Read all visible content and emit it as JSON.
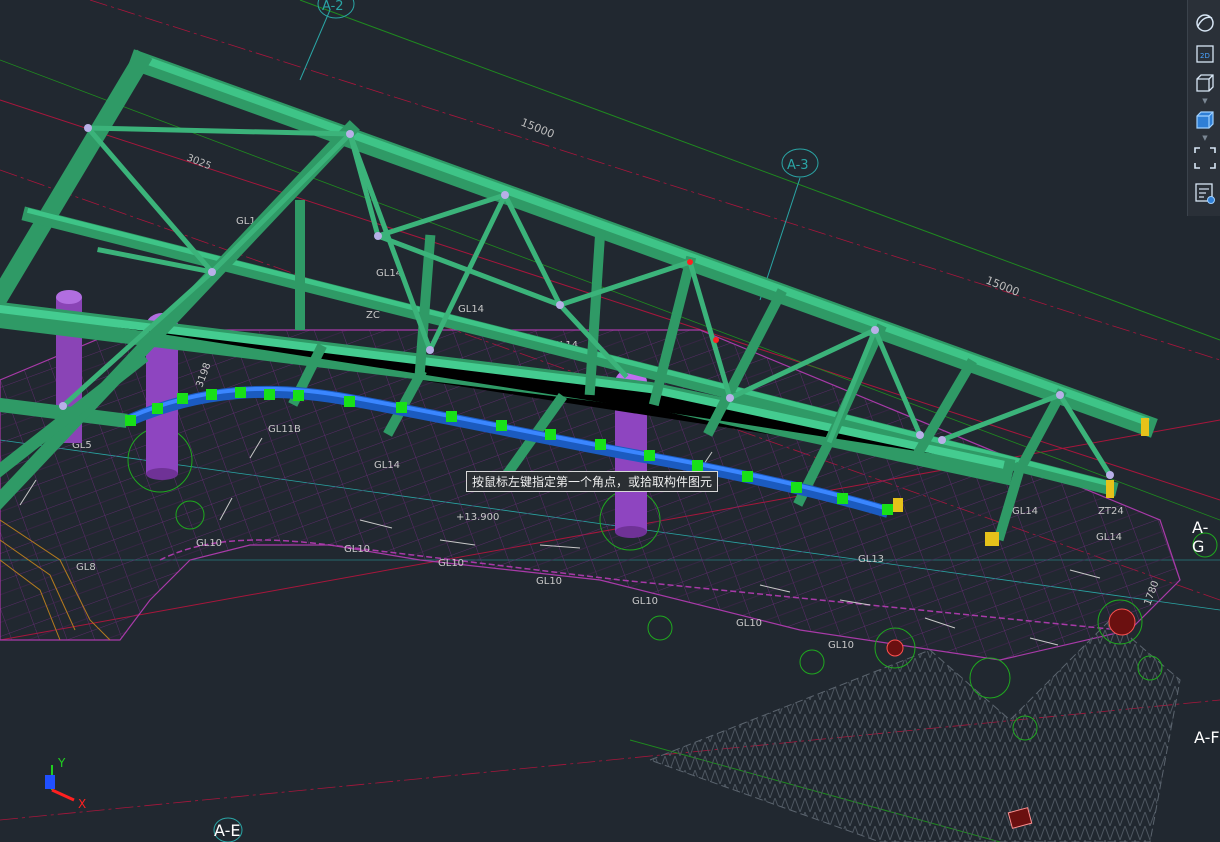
{
  "viewport": {
    "grid_labels": {
      "a2": "A-2",
      "a3": "A-3",
      "ag": "A-G",
      "af": "A-F",
      "ae": "A-E"
    },
    "dimensions": {
      "d1": "15000",
      "d2": "15000",
      "d3": "3025"
    },
    "member_labels": {
      "gl5": "GL5",
      "gl8": "GL8",
      "gl10a": "GL10",
      "gl10b": "GL10",
      "gl10c": "GL10",
      "gl10d": "GL10",
      "gl10e": "GL10",
      "gl10f": "GL10",
      "gl10g": "GL10",
      "gl11b": "GL11B",
      "gl13": "GL13",
      "gl14a": "GL14",
      "gl14b": "GL14",
      "gl14c": "GL14",
      "gl14d": "GL14",
      "gl14e": "GL14",
      "gl14f": "GL14",
      "gl14g": "GL14",
      "zc": "ZC",
      "zt24": "ZT24",
      "elev": "+13.900",
      "d1780": "1780",
      "d3198": "3198"
    },
    "axis_x": "X",
    "axis_y": "Y"
  },
  "tooltip": {
    "text": "按鼠标左键指定第一个角点，或拾取构件图元"
  },
  "toolbar": {
    "items": [
      {
        "icon": "orbit-icon"
      },
      {
        "icon": "view-2d-icon",
        "label": "2D"
      },
      {
        "icon": "view-3d-wireframe-icon"
      },
      {
        "icon": "view-3d-solid-icon"
      },
      {
        "icon": "zoom-extents-icon"
      },
      {
        "icon": "properties-view-icon"
      }
    ]
  },
  "colors": {
    "background": "#212830",
    "truss": "#3bb37a",
    "column": "#9b4dca",
    "selected_beam": "#1f6fe0",
    "grip": "#18e018",
    "grid_line": "#a8163c",
    "hatch": "#7a2f86"
  }
}
